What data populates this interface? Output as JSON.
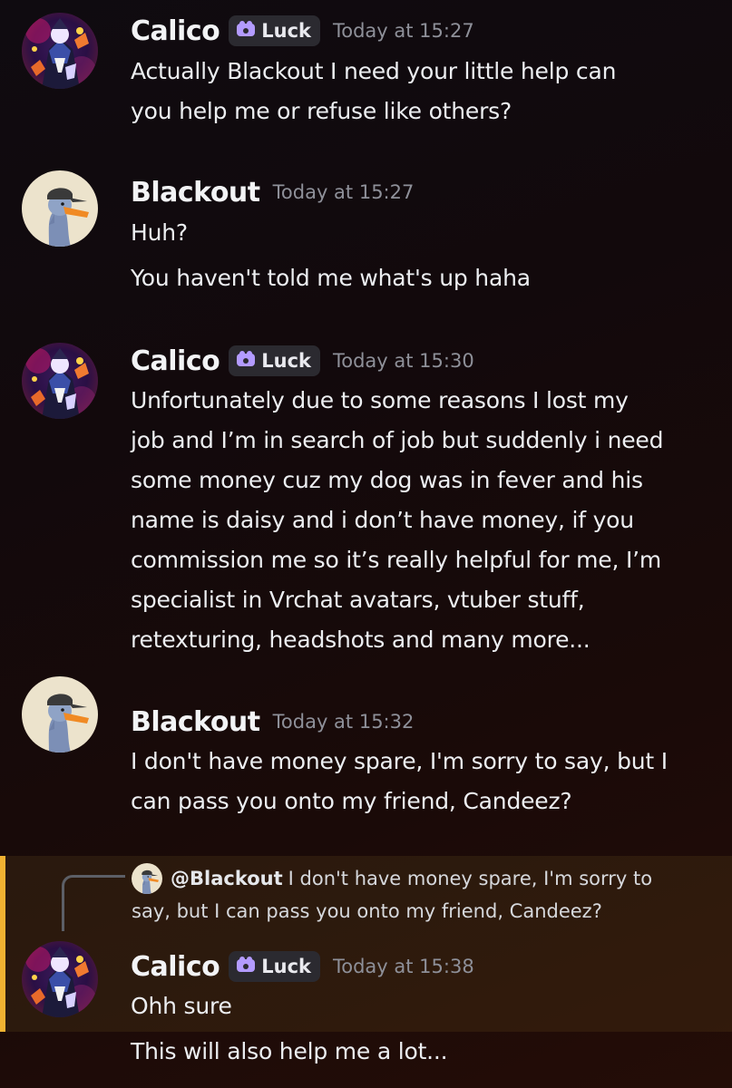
{
  "badge": {
    "label": "Luck",
    "color": "#b39bff"
  },
  "colors": {
    "reply_accent": "#f0b232",
    "timestamp": "#8e9099"
  },
  "messages": [
    {
      "author": "Calico",
      "badge": "Luck",
      "timestamp": "Today at 15:27",
      "lines": [
        "Actually Blackout I need your little help can",
        "you help me or refuse like others?"
      ]
    },
    {
      "author": "Blackout",
      "timestamp": "Today at 15:27",
      "lines": [
        "Huh?",
        "You haven't told me what's up haha"
      ]
    },
    {
      "author": "Calico",
      "badge": "Luck",
      "timestamp": "Today at 15:30",
      "lines": [
        "Unfortunately due to some reasons I lost my",
        "job and I’m in search of job but suddenly i need",
        "some money cuz my dog was in fever and his",
        "name is daisy and i don’t have money, if you",
        "commission me so it’s really helpful for me, I’m",
        "specialist in Vrchat avatars, vtuber stuff,",
        "retexturing, headshots and many more..."
      ]
    },
    {
      "author": "Blackout",
      "timestamp": "Today at 15:32",
      "lines": [
        "I don't have money spare, I'm sorry to say, but I",
        "can pass you onto my friend, Candeez?"
      ]
    },
    {
      "author": "Calico",
      "badge": "Luck",
      "timestamp": "Today at 15:38",
      "reply": {
        "mention": "@Blackout",
        "lines": [
          "I don't have money spare, I'm sorry to",
          "say, but I can pass you onto my friend, Candeez?"
        ]
      },
      "lines": [
        "Ohh sure",
        "This will also help me a lot..."
      ]
    }
  ]
}
